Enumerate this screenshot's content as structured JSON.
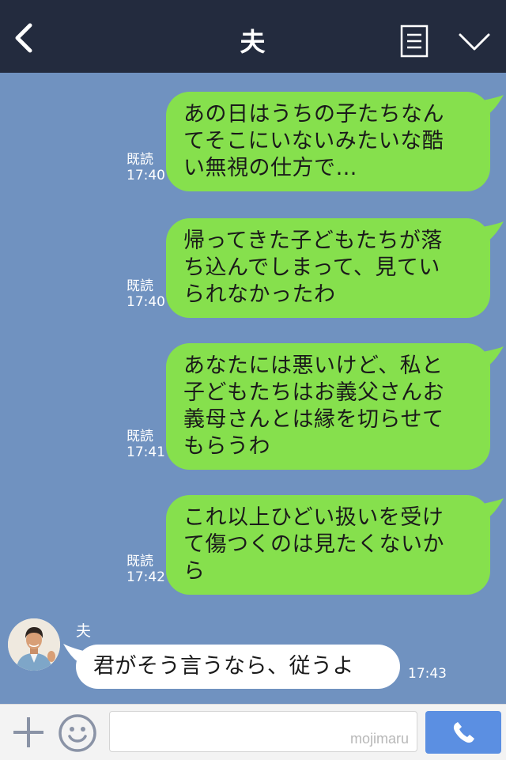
{
  "header": {
    "title": "夫",
    "back_icon": "chevron-left-icon",
    "menu_icon": "note-list-icon",
    "expand_icon": "chevron-down-icon"
  },
  "messages_out": [
    {
      "lines": [
        "あの日はうちの子たちなん",
        "てそこにいないみたいな酷",
        "い無視の仕方で…"
      ],
      "read": "既読",
      "time": "17:40"
    },
    {
      "lines": [
        "帰ってきた子どもたちが落",
        "ち込んでしまって、見てい",
        "られなかったわ"
      ],
      "read": "既読",
      "time": "17:40"
    },
    {
      "lines": [
        "あなたには悪いけど、私と",
        "子どもたちはお義父さんお",
        "義母さんとは縁を切らせて",
        "もらうわ"
      ],
      "read": "既読",
      "time": "17:41"
    },
    {
      "lines": [
        "これ以上ひどい扱いを受け",
        "て傷つくのは見たくないか",
        "ら"
      ],
      "read": "既読",
      "time": "17:42"
    }
  ],
  "message_in": {
    "sender": "夫",
    "text": "君がそう言うなら、従うよ",
    "time": "17:43"
  },
  "input_bar": {
    "watermark": "mojimaru",
    "plus_icon": "plus-icon",
    "emoji_icon": "smiley-icon",
    "call_icon": "phone-icon"
  },
  "colors": {
    "header_bg": "#232b3e",
    "chat_bg": "#7092c0",
    "outgoing_bubble": "#86e04d",
    "incoming_bubble": "#ffffff",
    "call_button": "#5b8fe2"
  }
}
